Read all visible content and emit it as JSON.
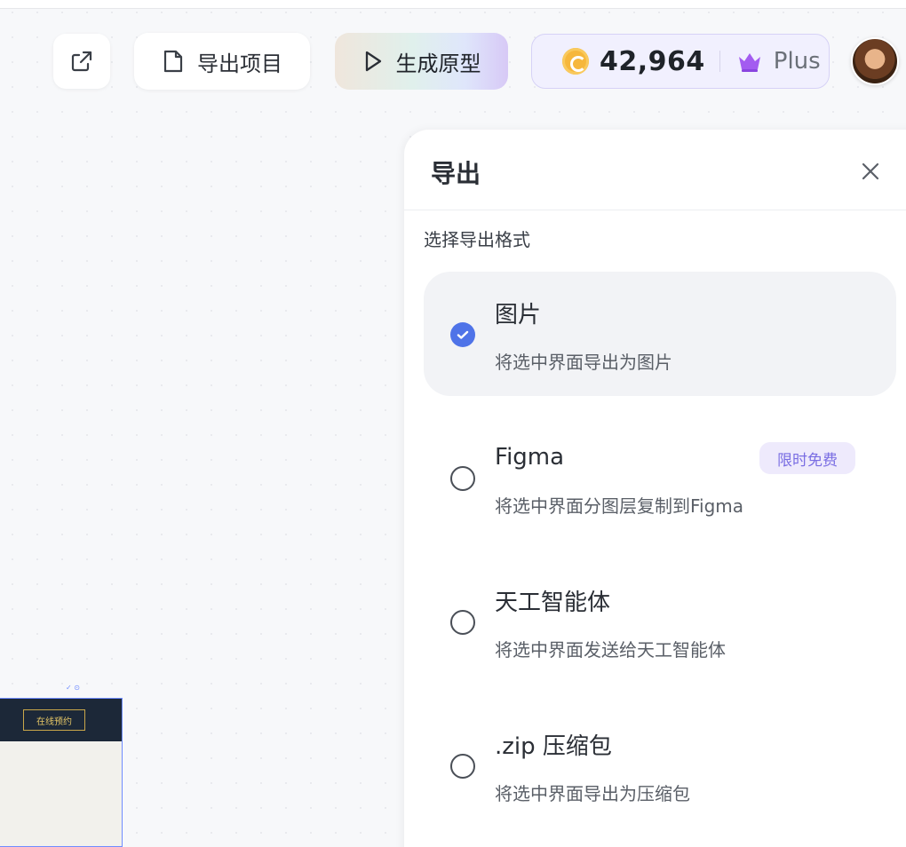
{
  "toolbar": {
    "share_icon": "external-link-icon",
    "export_project_label": "导出项目",
    "export_project_icon": "file-icon",
    "prototype_label": "生成原型",
    "prototype_icon": "play-icon",
    "credits_value": "42,964",
    "plan_label": "Plus",
    "accent_color": "#4f73e8"
  },
  "canvas": {
    "frame_button_label": "在线预约"
  },
  "export_panel": {
    "title": "导出",
    "section_label": "选择导出格式",
    "options": [
      {
        "title": "图片",
        "description": "将选中界面导出为图片",
        "selected": true
      },
      {
        "title": "Figma",
        "description": "将选中界面分图层复制到Figma",
        "badge": "限时免费",
        "selected": false
      },
      {
        "title": "天工智能体",
        "description": "将选中界面发送给天工智能体",
        "selected": false
      },
      {
        "title": ".zip 压缩包",
        "description": "将选中界面导出为压缩包",
        "selected": false
      }
    ]
  }
}
